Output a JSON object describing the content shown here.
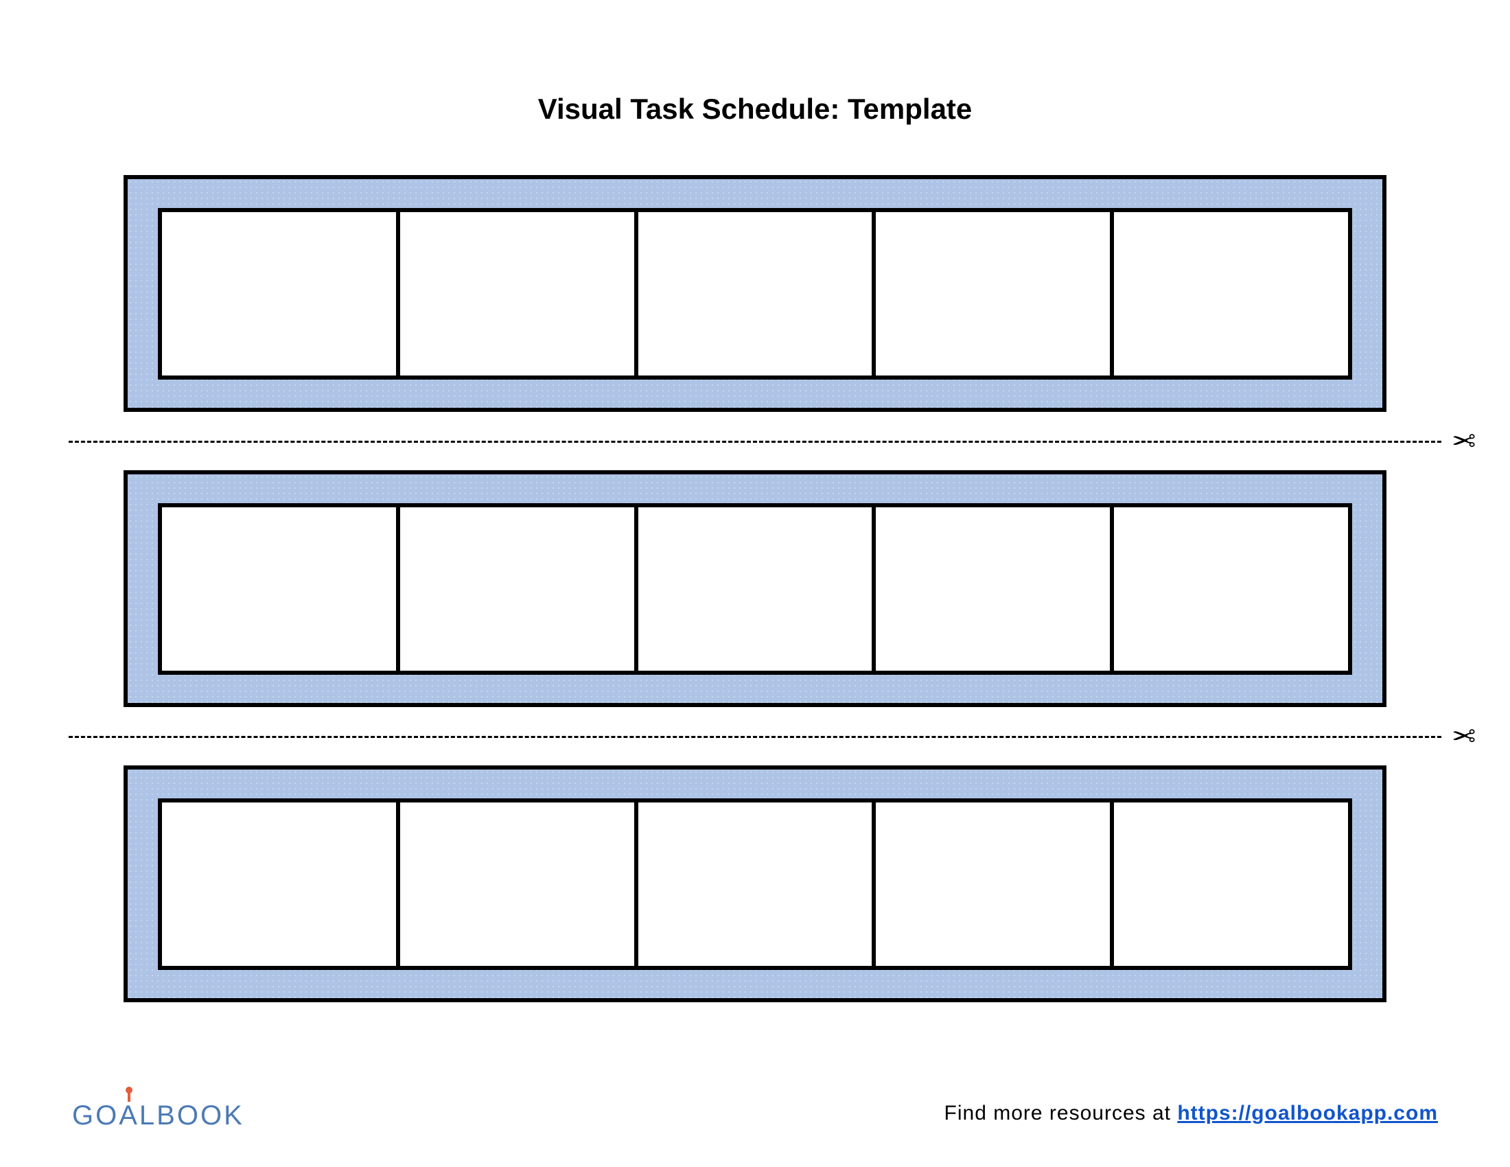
{
  "title": "Visual Task Schedule: Template",
  "strips": {
    "count": 3,
    "cells_per_strip": 5
  },
  "cut_icon": "scissors-icon",
  "logo": {
    "text_before_a": "GO",
    "a": "A",
    "text_after_a": "LBOOK"
  },
  "footer": {
    "prefix": "Find more resources at ",
    "link_text": "https://goalbookapp.com"
  },
  "colors": {
    "strip_bg": "#aec4e6",
    "border": "#000000",
    "logo": "#4b7ab5",
    "link": "#1155cc",
    "pin": "#e55b3c"
  }
}
